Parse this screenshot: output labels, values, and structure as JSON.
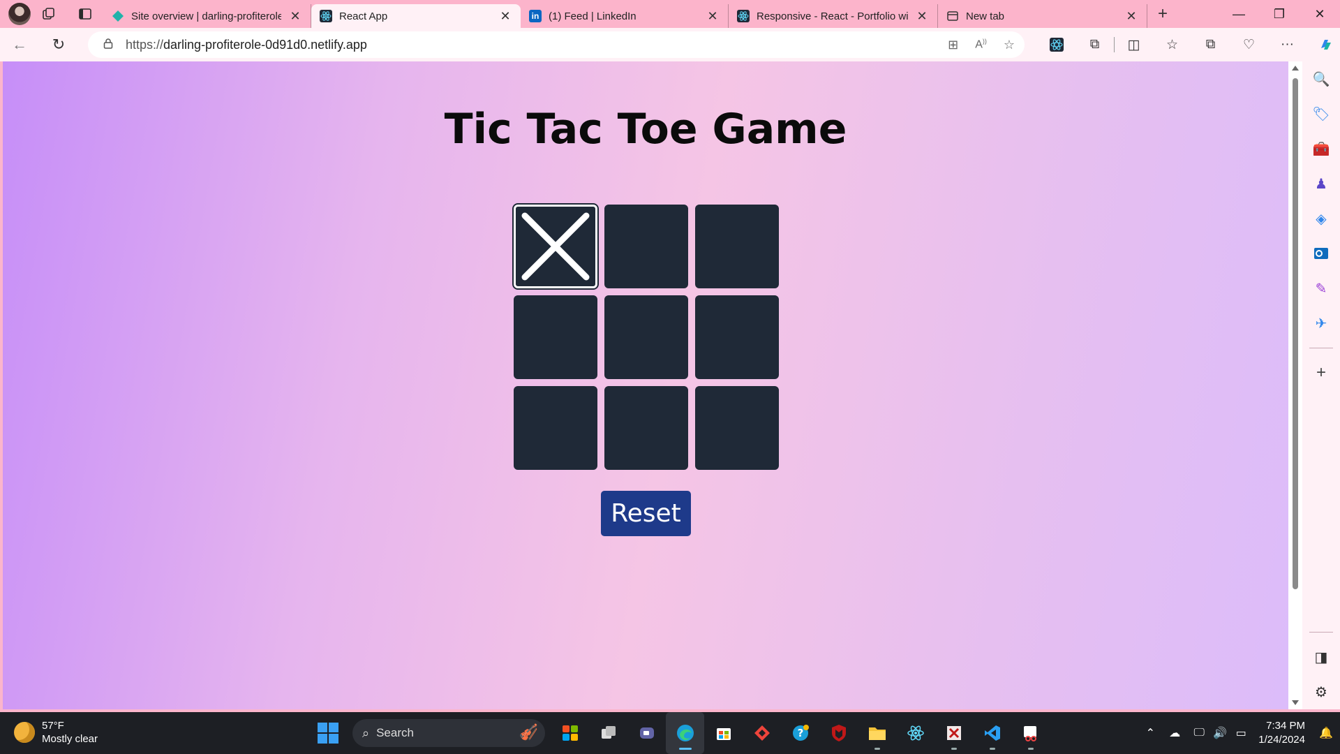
{
  "browser": {
    "tabs": [
      {
        "title": "Site overview | darling-profiterole",
        "favicon": "netlify-icon",
        "active": false
      },
      {
        "title": "React App",
        "favicon": "react-icon",
        "active": true
      },
      {
        "title": "(1) Feed | LinkedIn",
        "favicon": "linkedin-icon",
        "active": false
      },
      {
        "title": "Responsive - React - Portfolio wi",
        "favicon": "react-icon",
        "active": false
      },
      {
        "title": "New tab",
        "favicon": "newtab-icon",
        "active": false
      }
    ],
    "url_prefix": "https://",
    "url_host": "darling-profiterole-0d91d0.netlify.app"
  },
  "game": {
    "title": "Tic Tac Toe Game",
    "board": [
      "X",
      "",
      "",
      "",
      "",
      "",
      "",
      "",
      ""
    ],
    "reset_label": "Reset"
  },
  "taskbar": {
    "weather_temp": "57°F",
    "weather_desc": "Mostly clear",
    "search_label": "Search",
    "time": "7:34 PM",
    "date": "1/24/2024"
  },
  "colors": {
    "cell_bg": "#1f2937",
    "reset_bg": "#1e3a8a",
    "mark_color": "#ffffff"
  }
}
